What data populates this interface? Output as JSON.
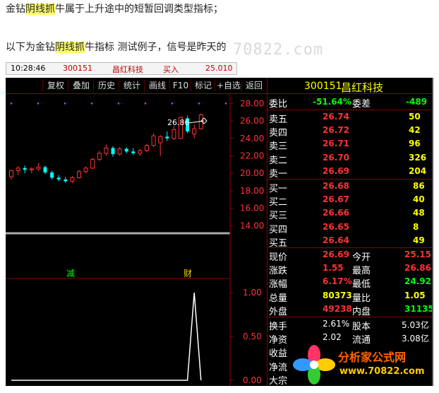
{
  "article": {
    "line1": {
      "pre": "金钻",
      "highlight": "阴线抓",
      "post": "牛属于上升途中的短暂回调类型指标；"
    },
    "line2": {
      "pre": "以下为金钻",
      "highlight": "阴线抓",
      "post": "牛指标 测试例子，信号是昨天的"
    },
    "watermark": "70822.com"
  },
  "order_strip": {
    "time": "10:28:46",
    "code": "300151",
    "name": "昌红科技",
    "action": "买入",
    "price": "25.010"
  },
  "toolbar": [
    "复权",
    "叠加",
    "历史",
    "统计",
    "画线",
    "F10",
    "标记",
    "+自选",
    "返回"
  ],
  "chart_data": {
    "type": "candlestick",
    "price_ticks": [
      "28.00",
      "26.00",
      "24.00",
      "22.00",
      "20.00",
      "18.00",
      "16.00",
      "14.00"
    ],
    "price_range": [
      13.3,
      29.0
    ],
    "peak_label": "26.86",
    "candles": [
      {
        "o": 19.6,
        "h": 20.4,
        "l": 19.3,
        "c": 20.3
      },
      {
        "o": 20.3,
        "h": 20.8,
        "l": 19.8,
        "c": 20.6
      },
      {
        "o": 20.6,
        "h": 20.9,
        "l": 20.0,
        "c": 20.4
      },
      {
        "o": 20.4,
        "h": 20.7,
        "l": 20.0,
        "c": 20.5
      },
      {
        "o": 20.5,
        "h": 21.2,
        "l": 20.3,
        "c": 20.7
      },
      {
        "o": 20.7,
        "h": 20.9,
        "l": 19.9,
        "c": 20.1
      },
      {
        "o": 20.1,
        "h": 20.3,
        "l": 19.3,
        "c": 19.5
      },
      {
        "o": 19.5,
        "h": 19.8,
        "l": 19.1,
        "c": 19.3
      },
      {
        "o": 19.3,
        "h": 19.6,
        "l": 18.9,
        "c": 19.1
      },
      {
        "o": 19.1,
        "h": 19.7,
        "l": 18.9,
        "c": 19.5
      },
      {
        "o": 19.5,
        "h": 20.4,
        "l": 19.4,
        "c": 20.2
      },
      {
        "o": 20.2,
        "h": 20.8,
        "l": 20.0,
        "c": 20.6
      },
      {
        "o": 20.6,
        "h": 21.8,
        "l": 20.5,
        "c": 21.6
      },
      {
        "o": 21.6,
        "h": 22.6,
        "l": 21.4,
        "c": 22.3
      },
      {
        "o": 22.3,
        "h": 23.3,
        "l": 22.0,
        "c": 22.9
      },
      {
        "o": 22.9,
        "h": 23.1,
        "l": 21.9,
        "c": 22.2
      },
      {
        "o": 22.2,
        "h": 23.0,
        "l": 22.0,
        "c": 22.8
      },
      {
        "o": 22.8,
        "h": 23.0,
        "l": 22.3,
        "c": 22.5
      },
      {
        "o": 22.5,
        "h": 22.9,
        "l": 22.1,
        "c": 22.3
      },
      {
        "o": 22.3,
        "h": 22.8,
        "l": 22.0,
        "c": 22.6
      },
      {
        "o": 22.6,
        "h": 23.4,
        "l": 22.4,
        "c": 23.2
      },
      {
        "o": 23.2,
        "h": 24.6,
        "l": 23.0,
        "c": 24.3
      },
      {
        "o": 23.5,
        "h": 24.4,
        "l": 22.0,
        "c": 24.2
      },
      {
        "o": 24.2,
        "h": 24.8,
        "l": 23.7,
        "c": 24.0
      },
      {
        "o": 24.0,
        "h": 25.4,
        "l": 23.8,
        "c": 25.0
      },
      {
        "o": 24.0,
        "h": 26.5,
        "l": 23.9,
        "c": 26.4
      },
      {
        "o": 26.3,
        "h": 26.6,
        "l": 24.6,
        "c": 24.8
      },
      {
        "o": 24.5,
        "h": 25.6,
        "l": 24.0,
        "c": 25.1
      },
      {
        "o": 25.1,
        "h": 26.86,
        "l": 25.0,
        "c": 26.69
      }
    ],
    "signal_labels": {
      "left": "减",
      "right": "财"
    },
    "indicator_ticks": [
      "1.00",
      "0.50",
      "0.00"
    ],
    "indicator_range": [
      0,
      1
    ],
    "indicator_values": [
      0,
      0,
      0,
      0,
      0,
      0,
      0,
      0,
      0,
      0,
      0,
      0,
      0,
      0,
      0,
      0,
      0,
      0,
      0,
      0,
      0,
      0,
      0,
      0,
      0,
      0,
      0,
      1,
      0
    ]
  },
  "quote": {
    "code": "300151",
    "name": "昌红科技",
    "wei_bi": {
      "label": "委比",
      "value": "-51.64%"
    },
    "wei_cha": {
      "label": "委差",
      "value": "-489"
    },
    "asks": [
      {
        "label": "卖五",
        "price": "26.74",
        "vol": "50"
      },
      {
        "label": "卖四",
        "price": "26.72",
        "vol": "42"
      },
      {
        "label": "卖三",
        "price": "26.71",
        "vol": "96"
      },
      {
        "label": "卖二",
        "price": "26.70",
        "vol": "326"
      },
      {
        "label": "卖一",
        "price": "26.69",
        "vol": "204"
      }
    ],
    "bids": [
      {
        "label": "买一",
        "price": "26.68",
        "vol": "86"
      },
      {
        "label": "买二",
        "price": "26.67",
        "vol": "40"
      },
      {
        "label": "买三",
        "price": "26.66",
        "vol": "48"
      },
      {
        "label": "买四",
        "price": "26.65",
        "vol": "8"
      },
      {
        "label": "买五",
        "price": "26.64",
        "vol": "49"
      }
    ],
    "stats": [
      {
        "l1": "现价",
        "v1": "26.69",
        "l2": "今开",
        "v2": "25.15"
      },
      {
        "l1": "涨跌",
        "v1": "1.55",
        "l2": "最高",
        "v2": "26.86"
      },
      {
        "l1": "涨幅",
        "v1": "6.17%",
        "l2": "最低",
        "v2": "24.92"
      },
      {
        "l1": "总量",
        "v1": "80373",
        "l2": "量比",
        "v2": "1.05"
      },
      {
        "l1": "外盘",
        "v1": "49238",
        "l2": "内盘",
        "v2": "31135"
      }
    ],
    "stats2": [
      {
        "l1": "换手",
        "v1": "2.61%",
        "l2": "股本",
        "v2": "5.03亿"
      },
      {
        "l1": "净资",
        "v1": "2.02",
        "l2": "流通",
        "v2": "3.08亿"
      },
      {
        "l1": "收益",
        "v1": "",
        "l2": "",
        "v2": ""
      },
      {
        "l1": "净流",
        "v1": "",
        "l2": "",
        "v2": ""
      },
      {
        "l1": "大宗",
        "v1": "",
        "l2": "",
        "v2": ""
      }
    ]
  },
  "logo": {
    "name": "分析家公式网",
    "url": "www.70822.com"
  },
  "colors": {
    "up": "#ff3333",
    "down": "#00ffff",
    "flat": "#ffffff",
    "yellow": "#ffff00",
    "green": "#00ff00"
  }
}
